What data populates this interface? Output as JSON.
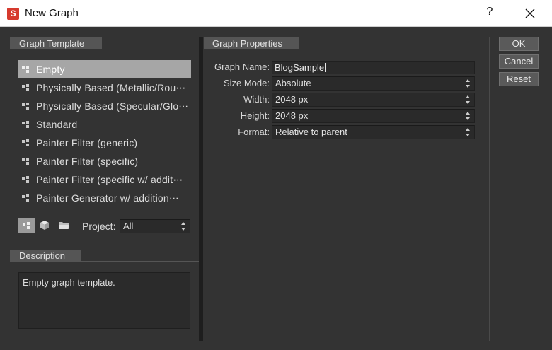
{
  "window": {
    "title": "New Graph",
    "help": "?",
    "app_icon": "substance-designer-icon",
    "close_icon": "close-icon"
  },
  "template_panel": {
    "header": "Graph Template",
    "items": [
      {
        "label": "Empty",
        "selected": true
      },
      {
        "label": "Physically Based (Metallic/Rou⋯",
        "selected": false
      },
      {
        "label": "Physically Based (Specular/Glo⋯",
        "selected": false
      },
      {
        "label": "Standard",
        "selected": false
      },
      {
        "label": "Painter Filter (generic)",
        "selected": false
      },
      {
        "label": "Painter Filter (specific)",
        "selected": false
      },
      {
        "label": "Painter Filter (specific w/ addit⋯",
        "selected": false
      },
      {
        "label": "Painter Generator w/ addition⋯",
        "selected": false
      }
    ],
    "toolbar": {
      "graph_icon": "graph-template-icon",
      "cube_icon": "cube-icon",
      "folder_icon": "folder-icon",
      "project_label": "Project:",
      "project_value": "All"
    }
  },
  "description_panel": {
    "header": "Description",
    "text": "Empty graph template."
  },
  "properties_panel": {
    "header": "Graph Properties",
    "graph_name_label": "Graph Name:",
    "graph_name_value": "BlogSample",
    "size_mode_label": "Size Mode:",
    "size_mode_value": "Absolute",
    "width_label": "Width:",
    "width_value": "2048 px",
    "height_label": "Height:",
    "height_value": "2048 px",
    "format_label": "Format:",
    "format_value": "Relative to parent"
  },
  "buttons": {
    "ok": "OK",
    "cancel": "Cancel",
    "reset": "Reset"
  },
  "colors": {
    "background": "#333333",
    "panel_header": "#555555",
    "selection": "#a6a6a6",
    "field": "#2a2a2a",
    "brand": "#d63a2e"
  }
}
